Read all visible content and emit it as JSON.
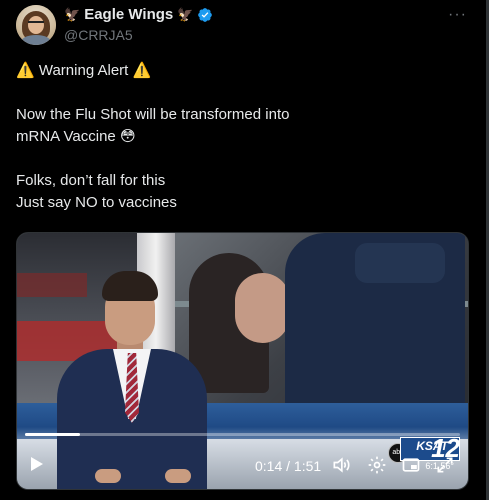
{
  "post": {
    "author": {
      "display_name": "Eagle Wings",
      "name_emoji_left": "🦅",
      "name_emoji_right": "🦅",
      "handle": "@CRRJA5",
      "verified": true
    },
    "more_menu_label": "···",
    "text": {
      "line1_emoji_left": "⚠️",
      "line1": "Warning Alert",
      "line1_emoji_right": "⚠️",
      "line2": "Now the Flu Shot will be transformed into",
      "line3": "mRNA Vaccine",
      "line3_emoji": "😳",
      "line4": "Folks, don’t fall for this",
      "line5": "Just say NO to vaccines"
    }
  },
  "video": {
    "current_time": "0:14",
    "time_separator": "/",
    "duration": "1:51",
    "progress_fraction": 0.126,
    "overlay": {
      "station": "KSAT",
      "channel": "12",
      "network": "abc",
      "temp_text": "6:1 56°"
    }
  },
  "colors": {
    "background": "#000000",
    "text_primary": "#e7e9ea",
    "text_secondary": "#71767b",
    "verified_blue": "#1d9bf0"
  },
  "icons": [
    "verified-badge-icon",
    "more-icon",
    "play-icon",
    "volume-icon",
    "settings-icon",
    "pip-icon",
    "fullscreen-icon"
  ]
}
